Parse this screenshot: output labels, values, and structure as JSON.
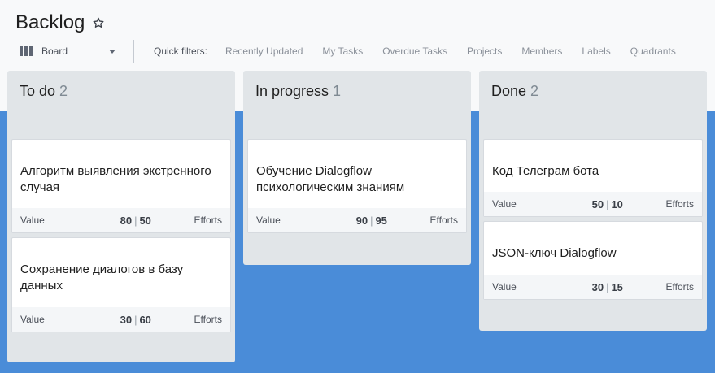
{
  "header": {
    "title": "Backlog",
    "star_icon": "star-outline-icon",
    "view": {
      "icon": "board-icon",
      "label": "Board"
    },
    "quick_filters_label": "Quick filters:",
    "quick_filters": [
      "Recently Updated",
      "My Tasks",
      "Overdue Tasks",
      "Projects",
      "Members",
      "Labels",
      "Quadrants"
    ]
  },
  "colors": {
    "background": "#4a8cd8",
    "column": "#e1e5e8",
    "card": "#ffffff",
    "card_footer": "#f4f6f8"
  },
  "columns": [
    {
      "name": "To do",
      "count": "2",
      "cards": [
        {
          "title": "Алгоритм выявления экстренного случая",
          "value_label": "Value",
          "value": "80",
          "efforts": "50",
          "efforts_label": "Efforts"
        },
        {
          "title": "Сохранение диалогов в базу данных",
          "value_label": "Value",
          "value": "30",
          "efforts": "60",
          "efforts_label": "Efforts"
        }
      ]
    },
    {
      "name": "In progress",
      "count": "1",
      "cards": [
        {
          "title": "Обучение Dialogflow психологическим знаниям",
          "value_label": "Value",
          "value": "90",
          "efforts": "95",
          "efforts_label": "Efforts"
        }
      ]
    },
    {
      "name": "Done",
      "count": "2",
      "cards": [
        {
          "title": "Код Телеграм бота",
          "value_label": "Value",
          "value": "50",
          "efforts": "10",
          "efforts_label": "Efforts"
        },
        {
          "title": "JSON-ключ Dialogflow",
          "value_label": "Value",
          "value": "30",
          "efforts": "15",
          "efforts_label": "Efforts"
        }
      ]
    }
  ]
}
